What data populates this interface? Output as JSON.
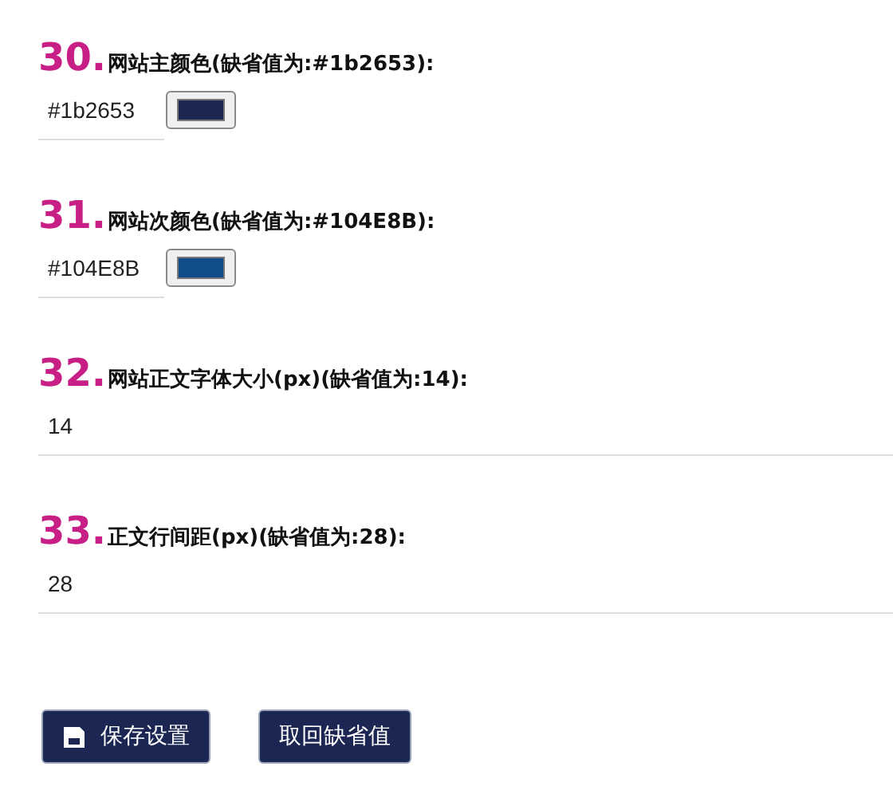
{
  "settings": [
    {
      "kind": "color",
      "number": "30.",
      "label": "网站主颜色(缺省值为:#1b2653):",
      "value": "#1b2653",
      "color": "#1b2653"
    },
    {
      "kind": "color",
      "number": "31.",
      "label": "网站次颜色(缺省值为:#104E8B):",
      "value": "#104E8B",
      "color": "#104e8b"
    },
    {
      "kind": "text",
      "number": "32.",
      "label": "网站正文字体大小(px)(缺省值为:14):",
      "value": "14"
    },
    {
      "kind": "text",
      "number": "33.",
      "label": "正文行间距(px)(缺省值为:28):",
      "value": "28"
    }
  ],
  "buttons": [
    {
      "kind": "save",
      "label": "保存设置"
    },
    {
      "kind": "reset",
      "label": "取回缺省值"
    }
  ]
}
